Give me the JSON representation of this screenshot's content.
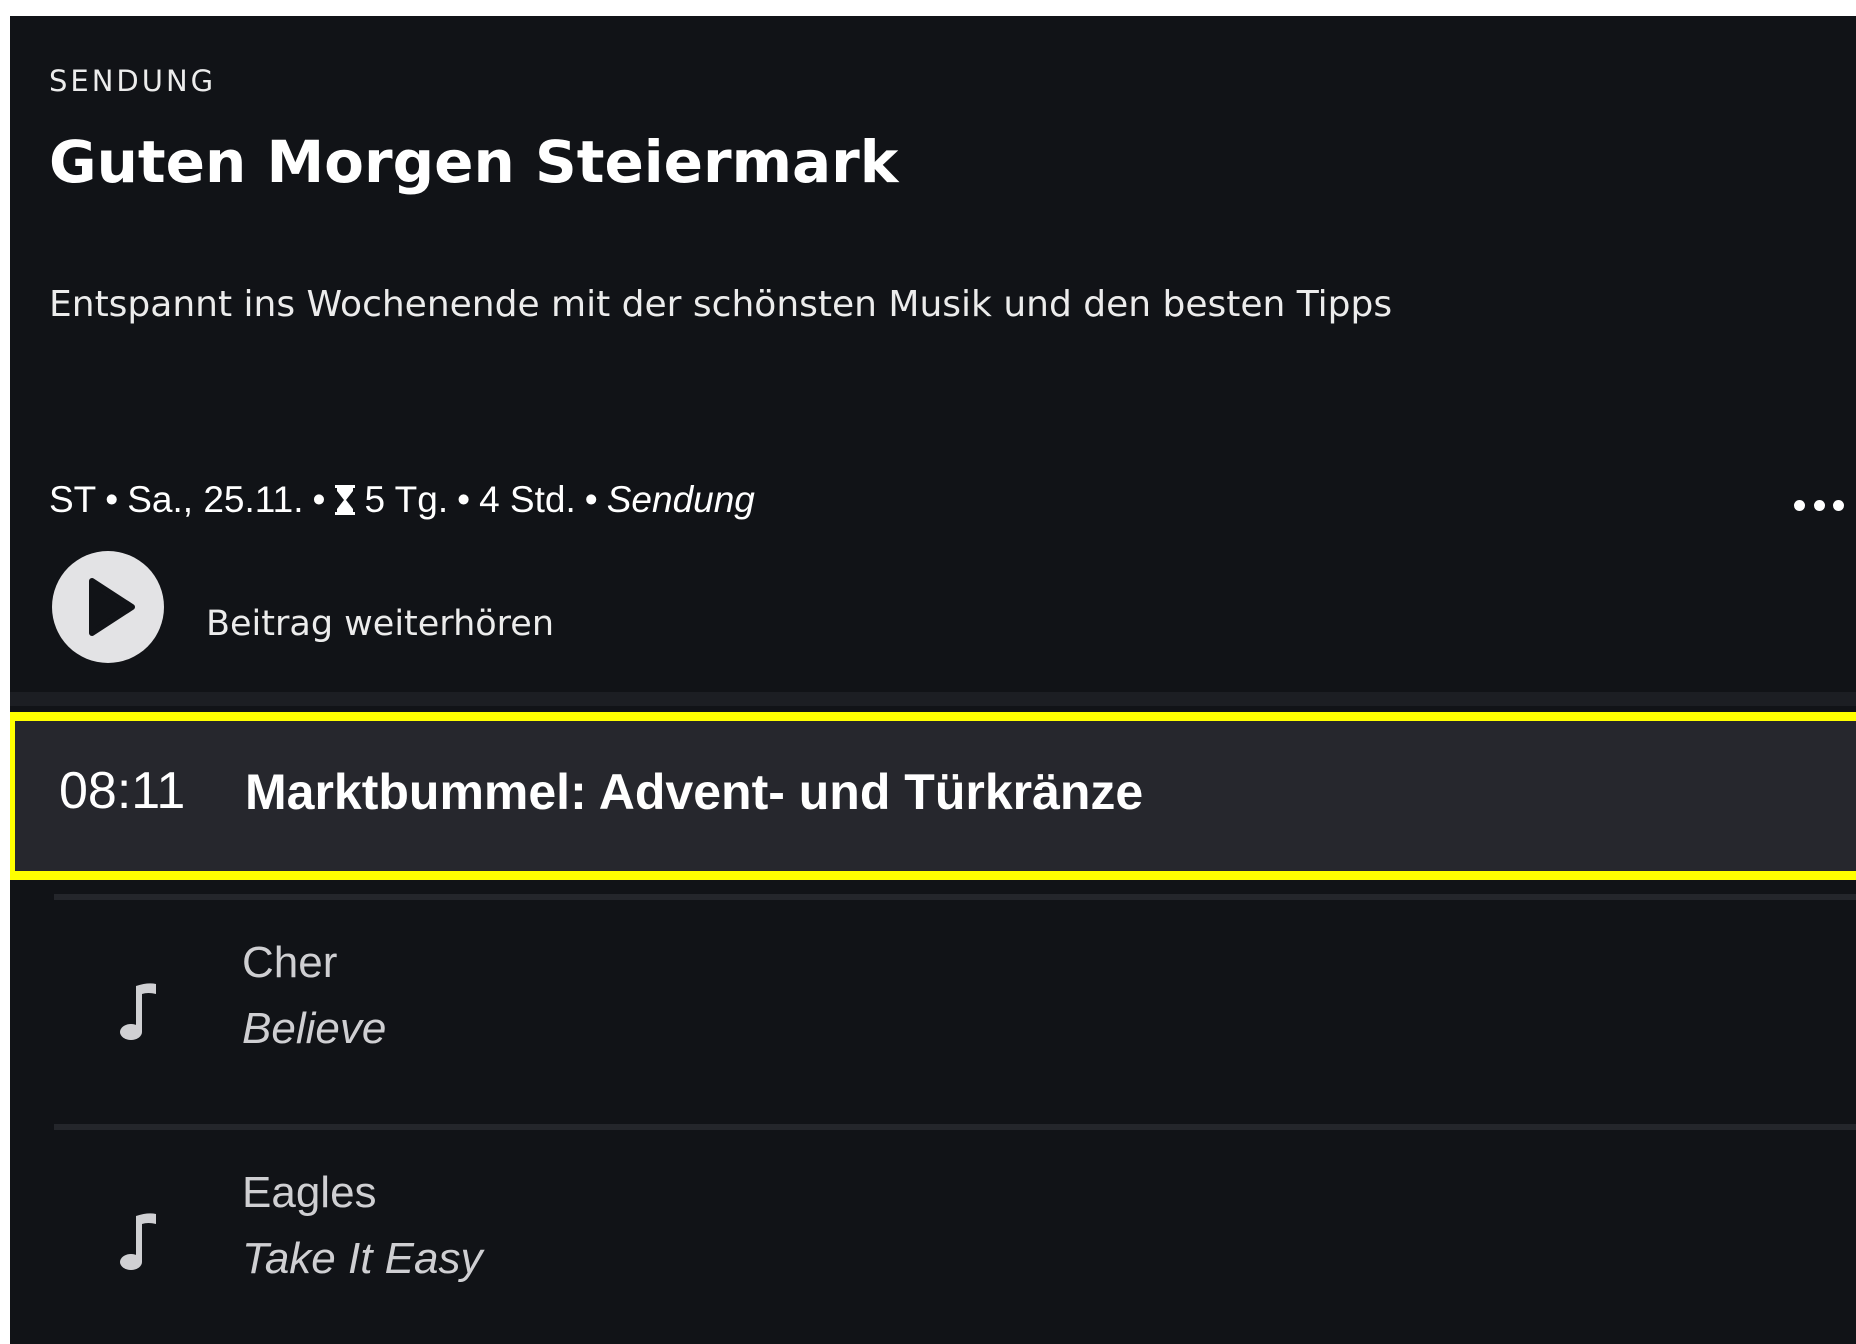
{
  "header": {
    "kicker": "SENDUNG",
    "title": "Guten Morgen Steiermark",
    "description": "Entspannt ins Wochenende mit der schönsten Musik und den besten Tipps"
  },
  "meta": {
    "station": "ST",
    "separator": "•",
    "date": "Sa., 25.11.",
    "availability": "5 Tg.",
    "duration": "4 Std.",
    "type": "Sendung",
    "availability_icon": "hourglass-icon",
    "more_icon": "more-options-icon"
  },
  "player": {
    "play_icon": "play-icon",
    "label": "Beitrag weiterhören"
  },
  "current_item": {
    "time": "08:11",
    "title": "Marktbummel: Advent- und Türkränze",
    "highlight_color": "#ffff00"
  },
  "songs": [
    {
      "icon": "music-note-icon",
      "artist": "Cher",
      "title": "Believe"
    },
    {
      "icon": "music-note-icon",
      "artist": "Eagles",
      "title": "Take It Easy"
    }
  ],
  "colors": {
    "background": "#111317",
    "highlight_row": "#26272d",
    "accent": "#ffff00"
  }
}
